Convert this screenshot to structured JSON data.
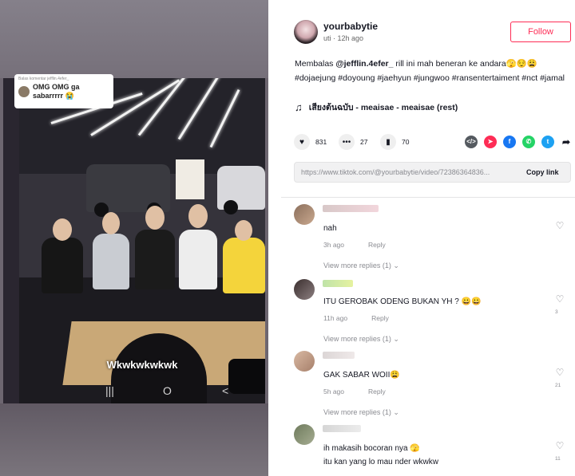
{
  "video": {
    "reply_sticker": {
      "header": "Balas komentar jefflin.4efer_",
      "text": "OMG OMG ga sabarrrrr 😭"
    },
    "caption": "Wkwkwkwkwk",
    "nav": [
      "|||",
      "O",
      "<"
    ]
  },
  "author": {
    "username": "yourbabytie",
    "meta": "uti · 12h ago",
    "follow_label": "Follow"
  },
  "description": {
    "prefix": "Membalas ",
    "mention": "@jefflin.4efer_",
    "body": " rill ini mah beneran ke andara🫣😌😩",
    "hashtags": "#dojaejung #doyoung #jaehyun #jungwoo #ransentertaiment #nct #jamal"
  },
  "music": {
    "icon": "music-note-icon",
    "title": "เสียงต้นฉบับ - meaisae - meaisae (rest)"
  },
  "actions": {
    "likes": "831",
    "comments": "27",
    "saves": "70"
  },
  "share_icons": [
    {
      "name": "embed-icon",
      "color": "#555a60",
      "glyph": "</>"
    },
    {
      "name": "send-icon",
      "color": "#fe2c55",
      "glyph": "➤"
    },
    {
      "name": "facebook-icon",
      "color": "#1877f2",
      "glyph": "f"
    },
    {
      "name": "whatsapp-icon",
      "color": "#25d366",
      "glyph": "✆"
    },
    {
      "name": "twitter-icon",
      "color": "#1da1f2",
      "glyph": "t"
    },
    {
      "name": "share-icon",
      "color": "#161823",
      "glyph": "➦"
    }
  ],
  "link": {
    "url": "https://www.tiktok.com/@yourbabytie/video/72386364836...",
    "copy_label": "Copy link"
  },
  "comments": [
    {
      "text": "nah",
      "time": "3h ago",
      "reply": "Reply",
      "view_replies": "View more replies (1)",
      "likes": ""
    },
    {
      "text": "ITU GEROBAK ODENG BUKAN YH ? 😀😀",
      "time": "11h ago",
      "reply": "Reply",
      "view_replies": "View more replies (1)",
      "likes": "3"
    },
    {
      "text": "GAK SABAR WOII😩",
      "time": "5h ago",
      "reply": "Reply",
      "view_replies": "View more replies (1)",
      "likes": "21"
    },
    {
      "text": "ih makasih bocoran nya 🫣",
      "text2": "itu kan yang lo mau nder wkwkw",
      "time": "",
      "reply": "",
      "view_replies": "",
      "likes": "11"
    }
  ],
  "colors": {
    "accent": "#fe2c55",
    "text": "#161823",
    "muted": "#8a8b91"
  }
}
